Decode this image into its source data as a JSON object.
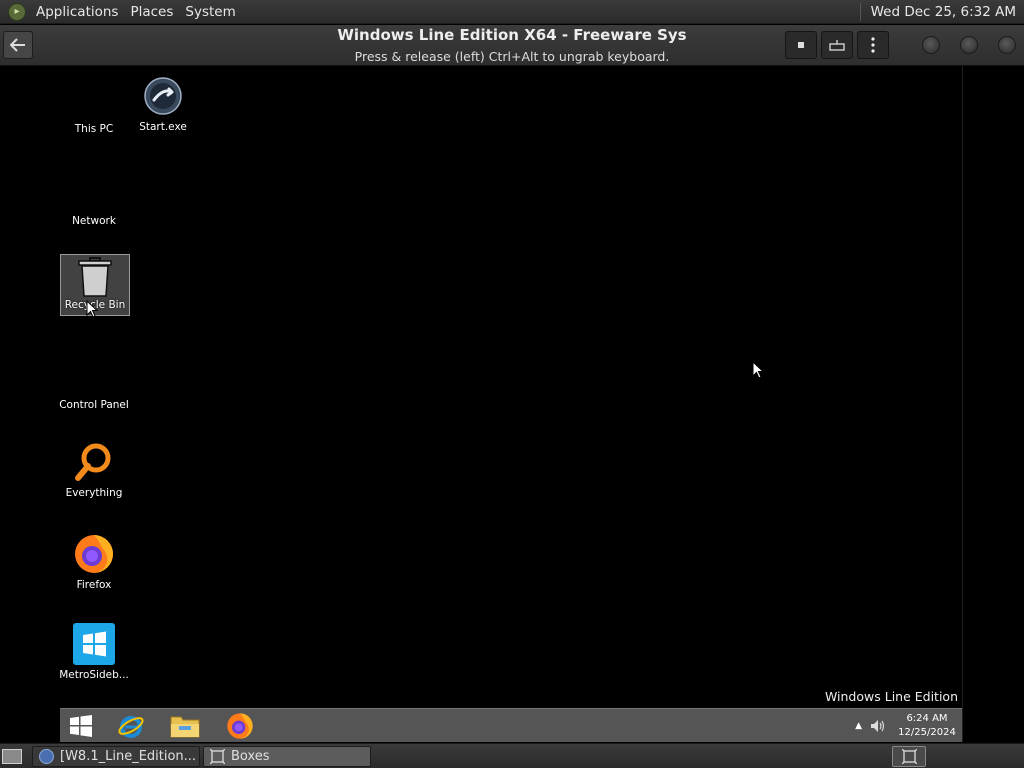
{
  "top_panel": {
    "menu": [
      "Applications",
      "Places",
      "System"
    ],
    "clock": "Wed Dec 25,  6:32 AM"
  },
  "headerbar": {
    "title": "Windows Line Edition X64 - Freeware Sys",
    "subtitle": "Press & release (left) Ctrl+Alt to ungrab keyboard."
  },
  "desktop": {
    "icons": [
      {
        "label": "This PC",
        "icon": "this-pc-icon"
      },
      {
        "label": "Start.exe",
        "icon": "start-exe-icon"
      },
      {
        "label": "Network",
        "icon": "network-icon"
      },
      {
        "label": "Recycle Bin",
        "icon": "recycle-bin-icon",
        "selected": true
      },
      {
        "label": "Control Panel",
        "icon": "control-panel-icon"
      },
      {
        "label": "Everything",
        "icon": "everything-search-icon"
      },
      {
        "label": "Firefox",
        "icon": "firefox-icon"
      },
      {
        "label": "MetroSideb...",
        "icon": "metro-sidebar-icon"
      }
    ],
    "watermark": "Windows Line Edition"
  },
  "win_taskbar": {
    "pins": [
      "windows-start-icon",
      "internet-explorer-icon",
      "file-explorer-icon",
      "firefox-icon"
    ],
    "clock_time": "6:24 AM",
    "clock_date": "12/25/2024"
  },
  "bottom_panel": {
    "tasks": [
      {
        "label": "[W8.1_Line_Edition...",
        "active": false
      },
      {
        "label": "Boxes",
        "active": true
      }
    ]
  },
  "colors": {
    "panel_bg": "#2e2e2e",
    "vm_bg": "#000000",
    "taskbar_bg": "#5a5a5a",
    "everything_orange": "#f28a1c",
    "metro_blue": "#1ea7e8"
  }
}
